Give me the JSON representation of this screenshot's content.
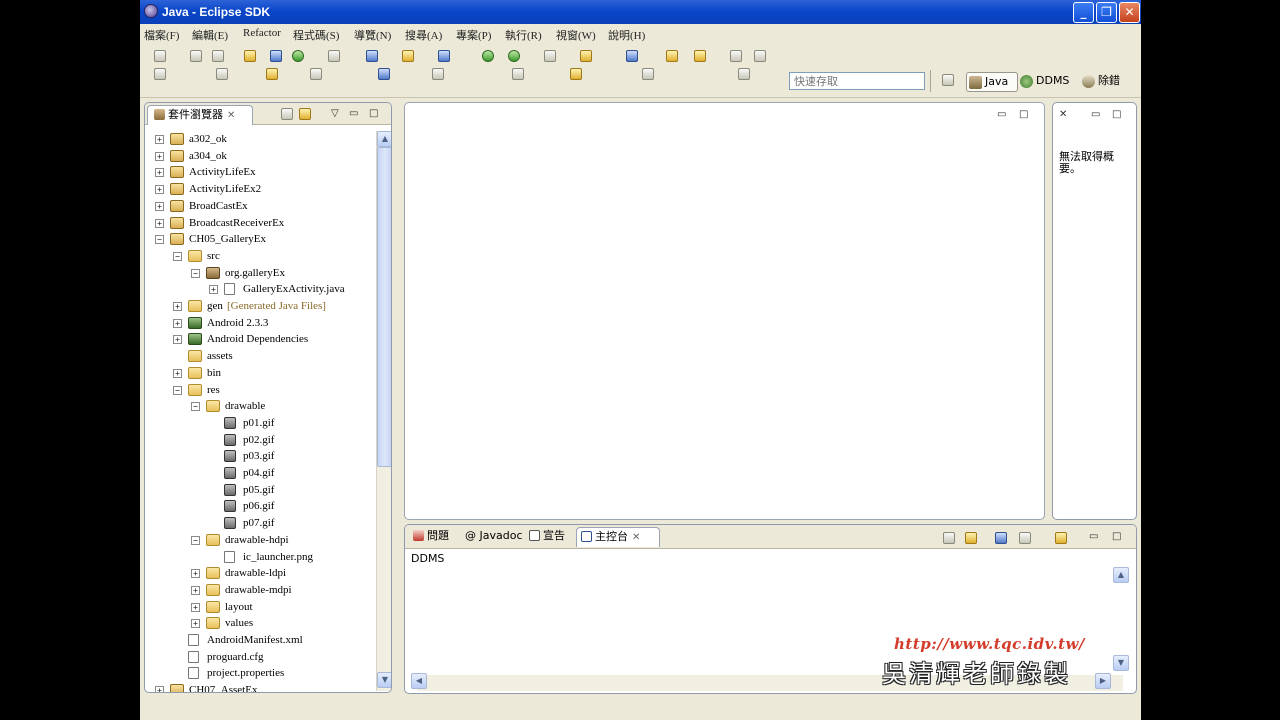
{
  "window": {
    "title": "Java - Eclipse SDK",
    "minimize": "_",
    "restore": "❐",
    "close": "✕"
  },
  "menu": [
    "檔案(F)",
    "編輯(E)",
    "Refactor",
    "程式碼(S)",
    "導覽(N)",
    "搜尋(A)",
    "專案(P)",
    "執行(R)",
    "視窗(W)",
    "說明(H)"
  ],
  "quick_access": {
    "placeholder": "快速存取"
  },
  "perspectives": [
    {
      "label": "Java",
      "active": true
    },
    {
      "label": "DDMS",
      "active": false
    },
    {
      "label": "除錯",
      "active": false
    }
  ],
  "package_explorer": {
    "tab_label": "套件瀏覽器",
    "close": "✕",
    "tree": [
      {
        "label": "a302_ok",
        "indent": 0,
        "toggle": "+",
        "icon": "proj"
      },
      {
        "label": "a304_ok",
        "indent": 0,
        "toggle": "+",
        "icon": "proj"
      },
      {
        "label": "ActivityLifeEx",
        "indent": 0,
        "toggle": "+",
        "icon": "proj"
      },
      {
        "label": "ActivityLifeEx2",
        "indent": 0,
        "toggle": "+",
        "icon": "proj"
      },
      {
        "label": "BroadCastEx",
        "indent": 0,
        "toggle": "+",
        "icon": "proj"
      },
      {
        "label": "BroadcastReceiverEx",
        "indent": 0,
        "toggle": "+",
        "icon": "proj"
      },
      {
        "label": "CH05_GalleryEx",
        "indent": 0,
        "toggle": "-",
        "icon": "proj"
      },
      {
        "label": "src",
        "indent": 1,
        "toggle": "-",
        "icon": "folder"
      },
      {
        "label": "org.galleryEx",
        "indent": 2,
        "toggle": "-",
        "icon": "pkg"
      },
      {
        "label": "GalleryExActivity.java",
        "indent": 3,
        "toggle": "+",
        "icon": "file"
      },
      {
        "label": "gen",
        "decor": "[Generated Java Files]",
        "indent": 1,
        "toggle": "+",
        "icon": "folder"
      },
      {
        "label": "Android 2.3.3",
        "indent": 1,
        "toggle": "+",
        "icon": "lib"
      },
      {
        "label": "Android Dependencies",
        "indent": 1,
        "toggle": "+",
        "icon": "lib"
      },
      {
        "label": "assets",
        "indent": 1,
        "toggle": "",
        "icon": "folder"
      },
      {
        "label": "bin",
        "indent": 1,
        "toggle": "+",
        "icon": "folder"
      },
      {
        "label": "res",
        "indent": 1,
        "toggle": "-",
        "icon": "folder"
      },
      {
        "label": "drawable",
        "indent": 2,
        "toggle": "-",
        "icon": "folder"
      },
      {
        "label": "p01.gif",
        "indent": 3,
        "toggle": "",
        "icon": "gif"
      },
      {
        "label": "p02.gif",
        "indent": 3,
        "toggle": "",
        "icon": "gif"
      },
      {
        "label": "p03.gif",
        "indent": 3,
        "toggle": "",
        "icon": "gif"
      },
      {
        "label": "p04.gif",
        "indent": 3,
        "toggle": "",
        "icon": "gif"
      },
      {
        "label": "p05.gif",
        "indent": 3,
        "toggle": "",
        "icon": "gif"
      },
      {
        "label": "p06.gif",
        "indent": 3,
        "toggle": "",
        "icon": "gif"
      },
      {
        "label": "p07.gif",
        "indent": 3,
        "toggle": "",
        "icon": "gif"
      },
      {
        "label": "drawable-hdpi",
        "indent": 2,
        "toggle": "-",
        "icon": "folder"
      },
      {
        "label": "ic_launcher.png",
        "indent": 3,
        "toggle": "",
        "icon": "file"
      },
      {
        "label": "drawable-ldpi",
        "indent": 2,
        "toggle": "+",
        "icon": "folder"
      },
      {
        "label": "drawable-mdpi",
        "indent": 2,
        "toggle": "+",
        "icon": "folder"
      },
      {
        "label": "layout",
        "indent": 2,
        "toggle": "+",
        "icon": "folder"
      },
      {
        "label": "values",
        "indent": 2,
        "toggle": "+",
        "icon": "folder"
      },
      {
        "label": "AndroidManifest.xml",
        "indent": 1,
        "toggle": "",
        "icon": "file"
      },
      {
        "label": "proguard.cfg",
        "indent": 1,
        "toggle": "",
        "icon": "file"
      },
      {
        "label": "project.properties",
        "indent": 1,
        "toggle": "",
        "icon": "file"
      },
      {
        "label": "CH07_AssetEx",
        "indent": 0,
        "toggle": "+",
        "icon": "proj"
      }
    ]
  },
  "outline": {
    "message": "無法取得概要。"
  },
  "bottom_panel": {
    "tabs": [
      {
        "label": "問題",
        "active": false
      },
      {
        "label": "Javadoc",
        "active": false
      },
      {
        "label": "宣告",
        "active": false
      },
      {
        "label": "主控台",
        "active": true
      }
    ],
    "console_name": "DDMS"
  },
  "watermark": {
    "url": "http://www.tqc.idv.tw/",
    "signature": "吳清輝老師錄製"
  }
}
